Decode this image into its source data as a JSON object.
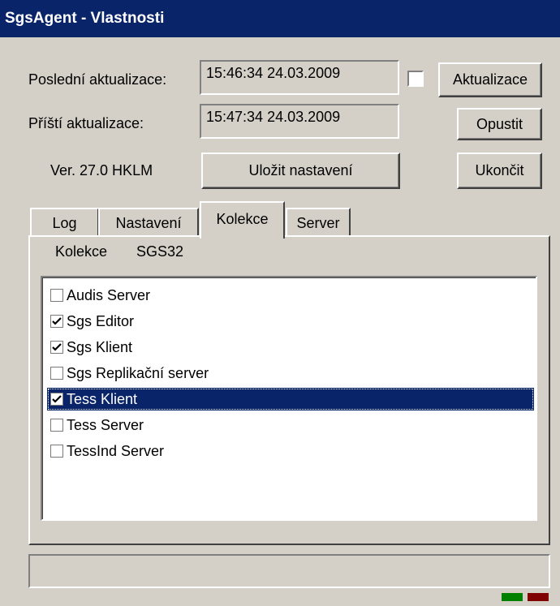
{
  "window": {
    "title": "SgsAgent - Vlastnosti"
  },
  "form": {
    "last_update_label": "Poslední aktualizace:",
    "last_update_value": "15:46:34  24.03.2009",
    "next_update_label": "Příští aktualizace:",
    "next_update_value": "15:47:34  24.03.2009",
    "version": "Ver. 27.0 HKLM",
    "auto_checkbox_checked": false
  },
  "buttons": {
    "refresh": "Aktualizace",
    "leave": "Opustit",
    "save": "Uložit nastavení",
    "quit": "Ukončit"
  },
  "tabs": [
    {
      "label": "Log",
      "active": false
    },
    {
      "label": "Nastavení",
      "active": false
    },
    {
      "label": "Kolekce",
      "active": true
    },
    {
      "label": "Server",
      "active": false
    }
  ],
  "collection": {
    "label": "Kolekce",
    "name": "SGS32",
    "items": [
      {
        "label": "Audis Server",
        "checked": false,
        "selected": false
      },
      {
        "label": "Sgs Editor",
        "checked": true,
        "selected": false
      },
      {
        "label": "Sgs Klient",
        "checked": true,
        "selected": false
      },
      {
        "label": "Sgs Replikační server",
        "checked": false,
        "selected": false
      },
      {
        "label": "Tess Klient",
        "checked": true,
        "selected": true
      },
      {
        "label": "Tess Server",
        "checked": false,
        "selected": false
      },
      {
        "label": "TessInd Server",
        "checked": false,
        "selected": false
      }
    ]
  },
  "status": {
    "indicator_colors": [
      "#008000",
      "#800000"
    ]
  }
}
